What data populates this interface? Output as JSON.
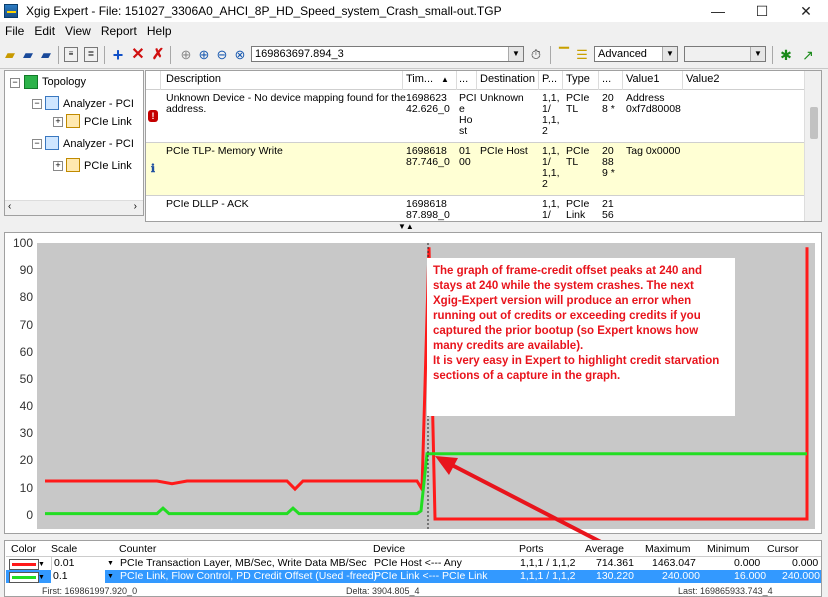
{
  "window": {
    "title": "Xgig Expert - File: 151027_3306A0_AHCI_8P_HD_Speed_system_Crash_small-out.TGP",
    "minimize": "—",
    "maximize": "☐",
    "close": "✕"
  },
  "menu": [
    "File",
    "Edit",
    "View",
    "Report",
    "Help"
  ],
  "toolbar": {
    "timestamp_value": "169863697.894_3",
    "mode_value": "Advanced"
  },
  "tree": {
    "root": "Topology",
    "analyzer1": "Analyzer - PCI",
    "link1": "PCIe Link",
    "analyzer2": "Analyzer - PCI",
    "link2": "PCIe Link"
  },
  "grid": {
    "columns": [
      "Description",
      "Tim...",
      "...",
      "Destination",
      "P...",
      "Type",
      "...",
      "Value1",
      "Value2"
    ],
    "sort_indicator": "▲",
    "rows": [
      {
        "description": "Unknown Device - No device mapping found for the\naddress.",
        "time": "1698623\n42.626_0",
        "source": "PCI\ne\nHo\nst",
        "destination": "Unknown",
        "port": "1,1,\n1/\n1,1,\n2",
        "type": "PCIe\nTL",
        "len": "20\n8 *",
        "value1": "Address\n0xf7d80008",
        "value2": ""
      },
      {
        "description": "PCIe TLP- Memory Write",
        "time": "1698618\n87.746_0",
        "source": "01\n00",
        "destination": "PCIe Host",
        "port": "1,1,\n1/\n1,1,\n2",
        "type": "PCIe\nTL",
        "len": "20\n88\n9 *",
        "value1": "Tag 0x0000",
        "value2": ""
      },
      {
        "description": "PCIe DLLP - ACK",
        "time": "1698618\n87.898_0",
        "source": "",
        "destination": "",
        "port": "1,1,\n1/",
        "type": "PCIe\nLink",
        "len": "21\n56",
        "value1": "",
        "value2": ""
      }
    ]
  },
  "graph": {
    "y_ticks": [
      "100",
      "90",
      "80",
      "70",
      "60",
      "50",
      "40",
      "30",
      "20",
      "10",
      "0"
    ],
    "annotation": [
      "The graph of frame-credit offset peaks at 240 and",
      "stays at 240 while the system crashes.  The next",
      "Xgig-Expert version will produce an error when",
      "running out of credits or exceeding credits if you",
      "captured the prior bootup (so Expert knows how",
      "many credits are available).",
      "It is very easy in Expert to highlight credit starvation",
      "sections of a capture in the graph."
    ],
    "colors": {
      "red": "#ff1a1a",
      "green": "#22dd22",
      "plot_bg": "#c8c8c8",
      "annotation": "#e8141c"
    }
  },
  "legend": {
    "headers": [
      "Color",
      "Scale",
      "Counter",
      "Device",
      "Ports",
      "Average",
      "Maximum",
      "Minimum",
      "Cursor"
    ],
    "rows": [
      {
        "scale": "0.01",
        "counter": "PCIe Transaction Layer, MB/Sec, Write Data MB/Sec",
        "device": "PCIe Host <--- Any",
        "ports": "1,1,1 / 1,1,2",
        "average": "714.361",
        "maximum": "1463.047",
        "minimum": "0.000",
        "cursor": "0.000"
      },
      {
        "scale": "0.1",
        "counter": "PCIe Link, Flow Control, PD Credit Offset (Used -freed)",
        "device": "PCIe Link <--- PCIe Link",
        "ports": "1,1,1 / 1,1,2",
        "average": "130.220",
        "maximum": "240.000",
        "minimum": "16.000",
        "cursor": "240.000"
      }
    ]
  },
  "status": {
    "first": "First: 169861997.920_0",
    "delta": "Delta: 3904.805_4",
    "last": "Last: 169865933.743_4"
  }
}
